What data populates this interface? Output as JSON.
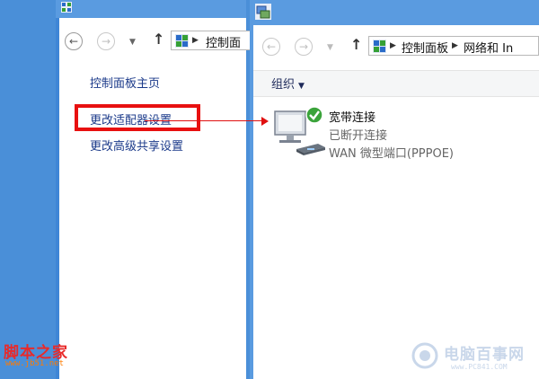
{
  "left_window": {
    "address_crumbs": [
      "控制面"
    ],
    "links": [
      "控制面板主页",
      "更改适配器设置",
      "更改高级共享设置"
    ]
  },
  "right_window": {
    "address_crumbs": [
      "控制面板",
      "网络和 In"
    ],
    "toolbar": {
      "organize_label": "组织"
    },
    "connection": {
      "name": "宽带连接",
      "status": "已断开连接",
      "device": "WAN 微型端口(PPPOE)"
    }
  },
  "watermarks": {
    "left_brand": "脚本之家",
    "left_url": "www.jb51.net",
    "right_brand": "电脑百事网",
    "right_url": "www.PC841.COM"
  },
  "colors": {
    "highlight": "#e81010",
    "desktop": "#4a8fd8",
    "link": "#1b3a8a"
  },
  "icons": [
    "control-panel-icon",
    "back-arrow-icon",
    "forward-arrow-icon",
    "up-arrow-icon",
    "network-connection-icon",
    "check-icon"
  ]
}
